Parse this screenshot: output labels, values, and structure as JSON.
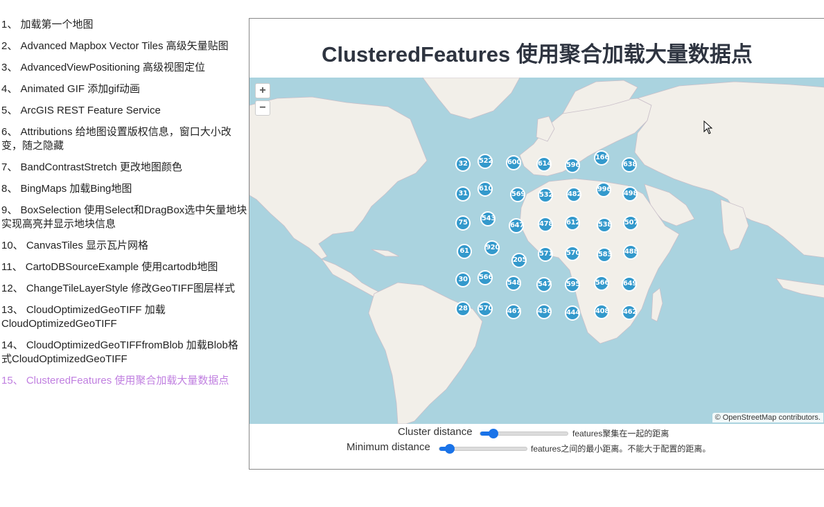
{
  "nav": {
    "items": [
      {
        "label": "1、 加载第一个地图"
      },
      {
        "label": "2、 Advanced Mapbox Vector Tiles 高级矢量贴图"
      },
      {
        "label": "3、 AdvancedViewPositioning 高级视图定位"
      },
      {
        "label": "4、 Animated GIF 添加gif动画"
      },
      {
        "label": "5、 ArcGIS REST Feature Service"
      },
      {
        "label": "6、 Attributions 给地图设置版权信息，窗口大小改变，随之隐藏"
      },
      {
        "label": "7、 BandContrastStretch 更改地图颜色"
      },
      {
        "label": "8、 BingMaps 加载Bing地图"
      },
      {
        "label": "9、 BoxSelection 使用Select和DragBox选中矢量地块实现高亮并显示地块信息"
      },
      {
        "label": "10、 CanvasTiles 显示瓦片网格"
      },
      {
        "label": "11、 CartoDBSourceExample 使用cartodb地图"
      },
      {
        "label": "12、 ChangeTileLayerStyle 修改GeoTIFF图层样式"
      },
      {
        "label": "13、 CloudOptimizedGeoTIFF 加载CloudOptimizedGeoTIFF"
      },
      {
        "label": "14、 CloudOptimizedGeoTIFFfromBlob 加载Blob格式CloudOptimizedGeoTIFF"
      },
      {
        "label": "15、 ClusteredFeatures 使用聚合加载大量数据点",
        "active": true
      }
    ]
  },
  "page": {
    "title": "ClusteredFeatures 使用聚合加载大量数据点"
  },
  "map": {
    "zoom_in_label": "+",
    "zoom_out_label": "−",
    "attribution": "© OpenStreetMap contributors.",
    "cluster_color": "#3399cc",
    "water_color": "#aad3df",
    "land_color": "#f2efe9",
    "clusters": [
      {
        "count": "32"
      },
      {
        "count": "522"
      },
      {
        "count": "600"
      },
      {
        "count": "614"
      },
      {
        "count": "596"
      },
      {
        "count": "166"
      },
      {
        "count": "638"
      },
      {
        "count": "31"
      },
      {
        "count": "610"
      },
      {
        "count": "569"
      },
      {
        "count": "532"
      },
      {
        "count": "482"
      },
      {
        "count": "996"
      },
      {
        "count": "498"
      },
      {
        "count": "75"
      },
      {
        "count": "543"
      },
      {
        "count": "647"
      },
      {
        "count": "478"
      },
      {
        "count": "612"
      },
      {
        "count": "538"
      },
      {
        "count": "507"
      },
      {
        "count": "61"
      },
      {
        "count": "920"
      },
      {
        "count": "205"
      },
      {
        "count": "571"
      },
      {
        "count": "570"
      },
      {
        "count": "583"
      },
      {
        "count": "488"
      },
      {
        "count": "30"
      },
      {
        "count": "566"
      },
      {
        "count": "548"
      },
      {
        "count": "547"
      },
      {
        "count": "595"
      },
      {
        "count": "566"
      },
      {
        "count": "649"
      },
      {
        "count": "28"
      },
      {
        "count": "570"
      },
      {
        "count": "467"
      },
      {
        "count": "436"
      },
      {
        "count": "444"
      },
      {
        "count": "408"
      },
      {
        "count": "462"
      }
    ]
  },
  "controls": {
    "distance_label": "Cluster distance",
    "distance_desc": "features聚集在一起的距离",
    "distance_value": 0.15,
    "min_label": "Minimum distance",
    "min_desc": "features之间的最小距离。不能大于配置的距离。",
    "min_value": 0.12,
    "accent": "#1a73e8"
  }
}
